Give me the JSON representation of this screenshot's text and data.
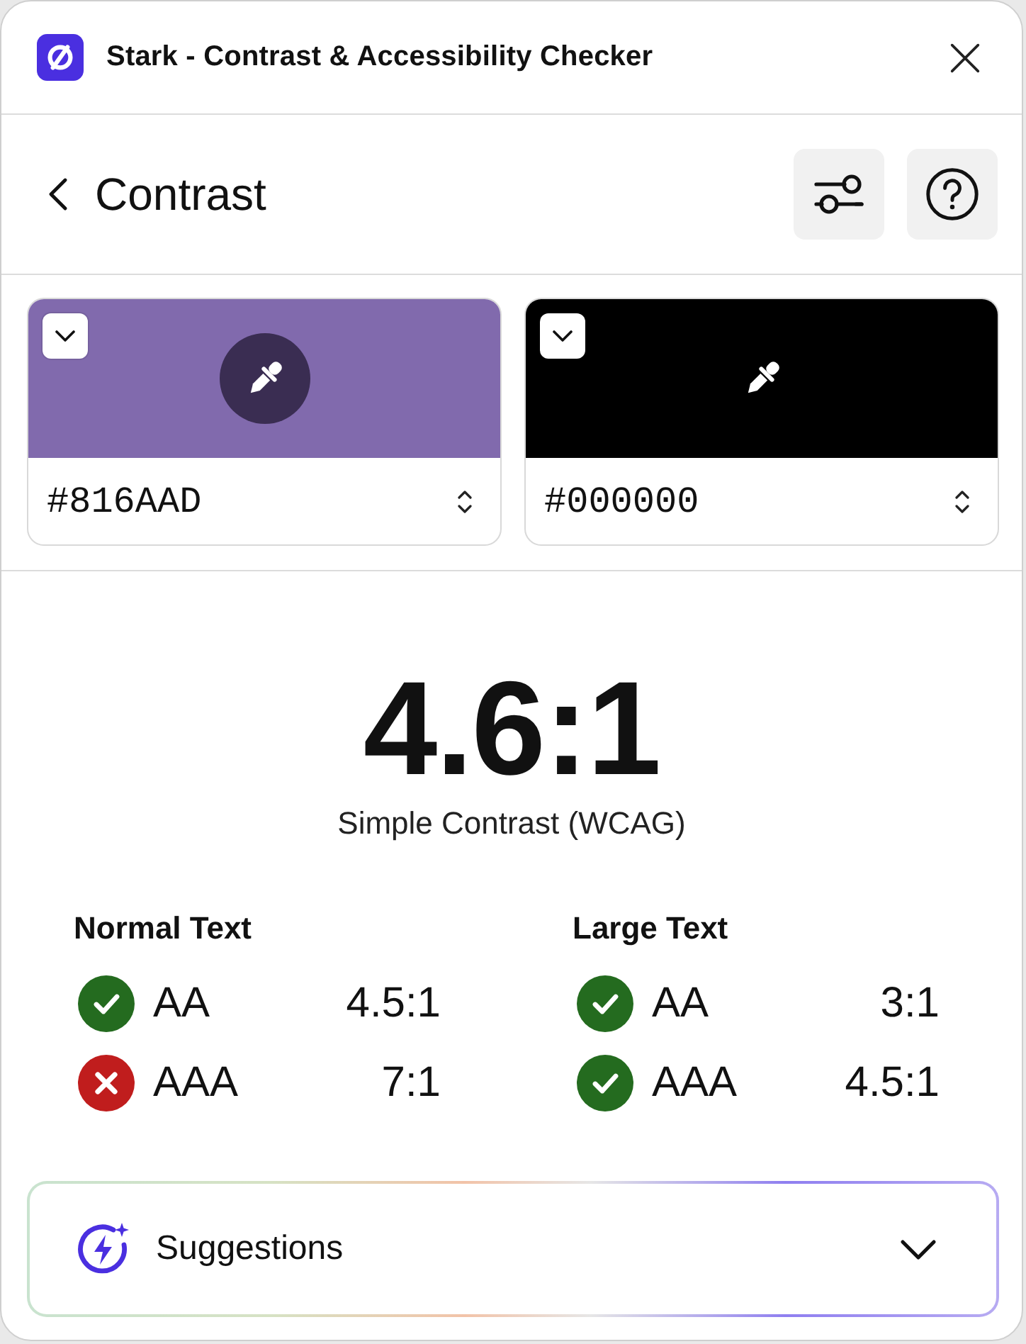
{
  "window": {
    "title": "Stark - Contrast & Accessibility Checker"
  },
  "header": {
    "title": "Contrast"
  },
  "colors": [
    {
      "hex": "#816AAD",
      "color": "#816aad",
      "picker_active": true
    },
    {
      "hex": "#000000",
      "color": "#000000",
      "picker_active": false
    }
  ],
  "ratio": {
    "value": "4.6:1",
    "label": "Simple Contrast (WCAG)"
  },
  "results": [
    {
      "heading": "Normal Text",
      "checks": [
        {
          "grade": "AA",
          "ratio": "4.5:1",
          "passed": true
        },
        {
          "grade": "AAA",
          "ratio": "7:1",
          "passed": false
        }
      ]
    },
    {
      "heading": "Large Text",
      "checks": [
        {
          "grade": "AA",
          "ratio": "3:1",
          "passed": true
        },
        {
          "grade": "AAA",
          "ratio": "4.5:1",
          "passed": true
        }
      ]
    }
  ],
  "suggestions": {
    "label": "Suggestions",
    "expanded": false
  }
}
